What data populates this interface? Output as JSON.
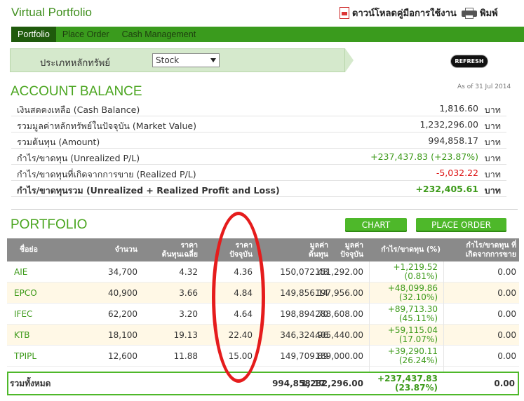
{
  "header": {
    "title": "Virtual Portfolio",
    "download_manual": "ดาวน์โหลดคู่มือการใช้งาน",
    "print": "พิมพ์"
  },
  "nav": {
    "tabs": [
      "Portfolio",
      "Place Order",
      "Cash Management"
    ],
    "active": "Portfolio"
  },
  "filter": {
    "label": "ประเภทหลักทรัพย์",
    "selected": "Stock",
    "refresh": "REFRESH"
  },
  "account_balance": {
    "title": "ACCOUNT BALANCE",
    "as_of": "As of 31 Jul 2014",
    "unit": "บาท",
    "rows": [
      {
        "label": "เงินสดคงเหลือ (Cash Balance)",
        "value": "1,816.60"
      },
      {
        "label": "รวมมูลค่าหลักทรัพย์ในปัจจุบัน (Market Value)",
        "value": "1,232,296.00"
      },
      {
        "label": "รวมต้นทุน (Amount)",
        "value": "994,858.17"
      },
      {
        "label": "กำไร/ขาดทุน (Unrealized P/L)",
        "value": "+237,437.83 (+23.87%)"
      },
      {
        "label": "กำไร/ขาดทุนที่เกิดจากการขาย (Realized P/L)",
        "value": "-5,032.22"
      },
      {
        "label": "กำไร/ขาดทุนรวม (Unrealized + Realized Profit and Loss)",
        "value": "+232,405.61"
      }
    ]
  },
  "portfolio": {
    "title": "PORTFOLIO",
    "chart_button": "CHART",
    "place_order_button": "PLACE ORDER",
    "headers": {
      "symbol": "ชื่อย่อ",
      "quantity": "จำนวน",
      "avg_cost_1": "ราคา",
      "avg_cost_2": "ต้นทุนเฉลี่ย",
      "current_1": "ราคา",
      "current_2": "ปัจจุบัน",
      "cost_value_1": "มูลค่า",
      "cost_value_2": "ต้นทุน",
      "market_value_1": "มูลค่า",
      "market_value_2": "ปัจจุบัน",
      "pl": "กำไร/ขาดทุน (%)",
      "realized_1": "กำไร/ขาดทุน ที่",
      "realized_2": "เกิดจากการขาย"
    },
    "rows": [
      {
        "symbol": "AIE",
        "qty": "34,700",
        "avg": "4.32",
        "price": "4.36",
        "cost": "150,072.48",
        "market": "151,292.00",
        "pl": "+1,219.52",
        "pl_pct": "(0.81%)",
        "realized": "0.00"
      },
      {
        "symbol": "EPCO",
        "qty": "40,900",
        "avg": "3.66",
        "price": "4.84",
        "cost": "149,856.14",
        "market": "197,956.00",
        "pl": "+48,099.86",
        "pl_pct": "(32.10%)",
        "realized": "0.00"
      },
      {
        "symbol": "IFEC",
        "qty": "62,200",
        "avg": "3.20",
        "price": "4.64",
        "cost": "198,894.70",
        "market": "288,608.00",
        "pl": "+89,713.30",
        "pl_pct": "(45.11%)",
        "realized": "0.00"
      },
      {
        "symbol": "KTB",
        "qty": "18,100",
        "avg": "19.13",
        "price": "22.40",
        "cost": "346,324.96",
        "market": "405,440.00",
        "pl": "+59,115.04",
        "pl_pct": "(17.07%)",
        "realized": "0.00"
      },
      {
        "symbol": "TPIPL",
        "qty": "12,600",
        "avg": "11.88",
        "price": "15.00",
        "cost": "149,709.89",
        "market": "189,000.00",
        "pl": "+39,290.11",
        "pl_pct": "(26.24%)",
        "realized": "0.00"
      }
    ],
    "total": {
      "label": "รวมทั้งหมด",
      "cost": "994,858.17",
      "market": "1,232,296.00",
      "pl": "+237,437.83",
      "pl_pct": "(23.87%)",
      "realized": "0.00"
    }
  }
}
